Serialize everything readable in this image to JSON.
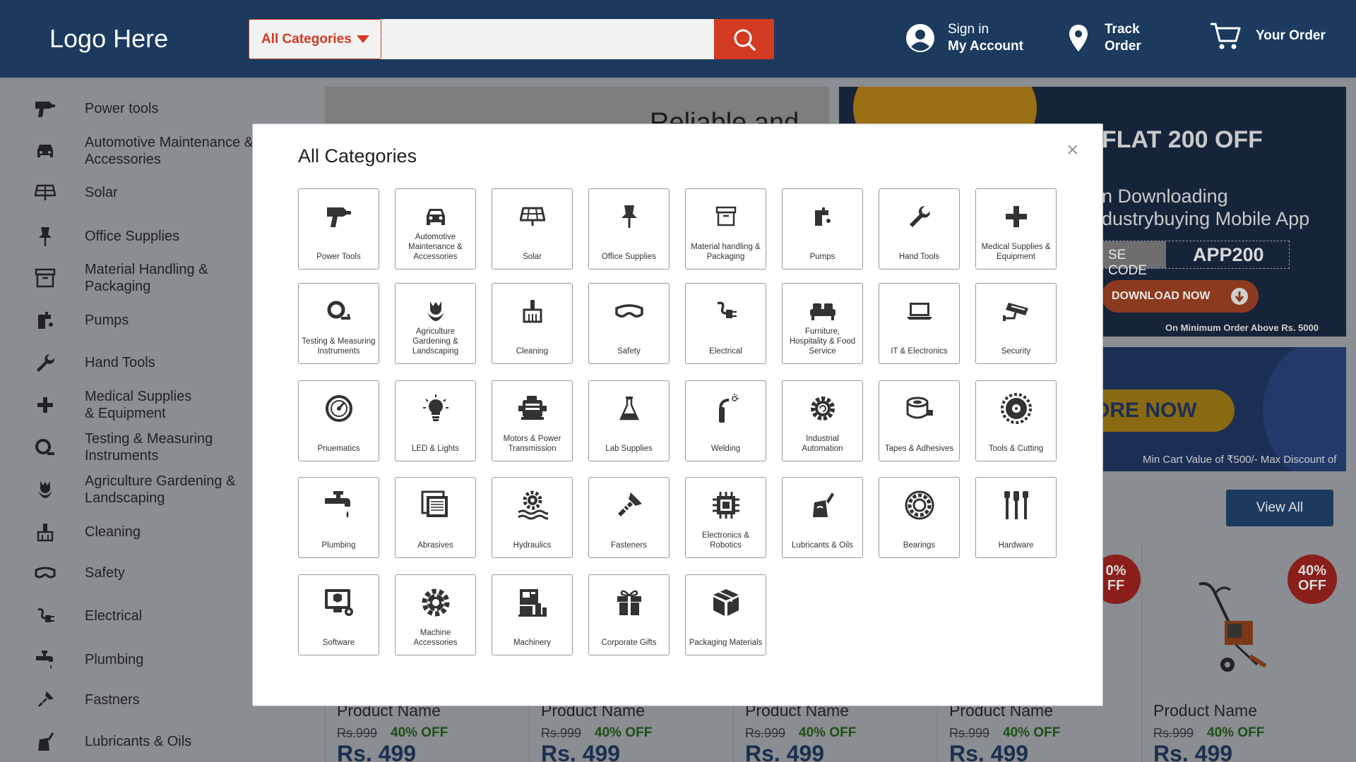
{
  "header": {
    "logo": "Logo Here",
    "category_select": "All Categories",
    "search_placeholder": "",
    "signin_line1": "Sign in",
    "signin_line2": "My Account",
    "track_line1": "Track",
    "track_line2": "Order",
    "order_label": "Your Order"
  },
  "sidebar": {
    "items": [
      {
        "label": "Power tools",
        "icon": "drill-icon"
      },
      {
        "label": "Automotive Maintenance & Accessories",
        "icon": "car-icon"
      },
      {
        "label": "Solar",
        "icon": "solar-panel-icon"
      },
      {
        "label": "Office Supplies",
        "icon": "pushpin-icon"
      },
      {
        "label": "Material Handling & Packaging",
        "icon": "archive-box-icon"
      },
      {
        "label": "Pumps",
        "icon": "pump-icon"
      },
      {
        "label": "Hand Tools",
        "icon": "wrench-icon"
      },
      {
        "label": "Medical Supplies & Equipment",
        "icon": "medical-cross-icon"
      },
      {
        "label": "Testing & Measuring Instruments",
        "icon": "measuring-tape-icon"
      },
      {
        "label": "Agriculture Gardening & Landscaping",
        "icon": "tulip-icon"
      },
      {
        "label": "Cleaning",
        "icon": "broom-icon"
      },
      {
        "label": "Safety",
        "icon": "goggles-icon"
      },
      {
        "label": "Electrical",
        "icon": "plug-icon"
      },
      {
        "label": "Plumbing",
        "icon": "faucet-icon"
      },
      {
        "label": "Fastners",
        "icon": "screw-icon"
      },
      {
        "label": "Lubricants & Oils",
        "icon": "oil-can-icon"
      }
    ]
  },
  "banners": {
    "banner1_text": "Reliable and",
    "flat_offer": "FLAT 200 OFF",
    "download_line1": "n Downloading",
    "download_line2": "dustrybuying Mobile App",
    "code_label": "SE CODE",
    "code_value": "APP200",
    "download_button": "DOWNLOAD NOW",
    "min_order": "On Minimum Order Above Rs. 5000",
    "explore_button": "ORE NOW",
    "min_cart": "Min Cart Value of ₹500/- Max Discount of"
  },
  "products": {
    "view_all": "View All",
    "items": [
      {
        "name": "Product Name",
        "old_price": "Rs.999",
        "discount": "40% OFF",
        "price": "Rs. 499"
      },
      {
        "name": "Product Name",
        "old_price": "Rs.999",
        "discount": "40% OFF",
        "price": "Rs. 499"
      },
      {
        "name": "Product Name",
        "old_price": "Rs.999",
        "discount": "40% OFF",
        "price": "Rs. 499"
      },
      {
        "name": "Product Name",
        "old_price": "Rs.999",
        "discount": "40% OFF",
        "price": "Rs. 499"
      },
      {
        "name": "Product Name",
        "old_price": "Rs.999",
        "discount": "40% OFF",
        "price": "Rs. 499"
      }
    ],
    "badge_partial_line1": "0%",
    "badge_partial_line2": "FF",
    "badge_line1": "40%",
    "badge_line2": "OFF"
  },
  "modal": {
    "title": "All Categories",
    "close": "×",
    "categories": [
      {
        "label": "Power Tools",
        "icon": "drill-icon"
      },
      {
        "label": "Automotive Maintenance & Accessories",
        "icon": "car-icon"
      },
      {
        "label": "Solar",
        "icon": "solar-panel-icon"
      },
      {
        "label": "Office Supplies",
        "icon": "pushpin-icon"
      },
      {
        "label": "Material handling & Packaging",
        "icon": "archive-box-icon"
      },
      {
        "label": "Pumps",
        "icon": "pump-icon"
      },
      {
        "label": "Hand Tools",
        "icon": "wrench-icon"
      },
      {
        "label": "Medical Supplies & Equipment",
        "icon": "medical-cross-icon"
      },
      {
        "label": "Testing & Measuring Instruments",
        "icon": "measuring-tape-icon"
      },
      {
        "label": "Agriculture Gardening & Landscaping",
        "icon": "tulip-icon"
      },
      {
        "label": "Cleaning",
        "icon": "broom-icon"
      },
      {
        "label": "Safety",
        "icon": "goggles-icon"
      },
      {
        "label": "Electrical",
        "icon": "plug-icon"
      },
      {
        "label": "Furniture, Hospitality & Food Service",
        "icon": "sofa-icon"
      },
      {
        "label": "IT & Electronics",
        "icon": "laptop-icon"
      },
      {
        "label": "Security",
        "icon": "cctv-camera-icon"
      },
      {
        "label": "Pnuematics",
        "icon": "pressure-gauge-icon"
      },
      {
        "label": "LED & Lights",
        "icon": "lightbulb-icon"
      },
      {
        "label": "Motors & Power Transmission",
        "icon": "motor-icon"
      },
      {
        "label": "Lab Supplies",
        "icon": "flask-icon"
      },
      {
        "label": "Welding",
        "icon": "welding-torch-icon"
      },
      {
        "label": "Industrial Automation",
        "icon": "gear-cycle-icon"
      },
      {
        "label": "Tapes & Adhesives",
        "icon": "tape-roll-icon"
      },
      {
        "label": "Tools & Cutting",
        "icon": "saw-blade-icon"
      },
      {
        "label": "Plumbing",
        "icon": "faucet-icon"
      },
      {
        "label": "Abrasives",
        "icon": "sandpaper-icon"
      },
      {
        "label": "Hydraulics",
        "icon": "hydraulic-gear-icon"
      },
      {
        "label": "Fasteners",
        "icon": "screw-icon"
      },
      {
        "label": "Electronics & Robotics",
        "icon": "chip-icon"
      },
      {
        "label": "Lubricants & Oils",
        "icon": "oil-can-icon"
      },
      {
        "label": "Bearings",
        "icon": "bearing-icon"
      },
      {
        "label": "Hardware",
        "icon": "hardware-tools-icon"
      },
      {
        "label": "Software",
        "icon": "software-monitor-icon"
      },
      {
        "label": "Machine Accessories",
        "icon": "machine-gear-icon"
      },
      {
        "label": "Machinery",
        "icon": "machinery-icon"
      },
      {
        "label": "Corporate Gifts",
        "icon": "gift-icon"
      },
      {
        "label": "Packaging Materials",
        "icon": "package-box-icon"
      }
    ]
  }
}
